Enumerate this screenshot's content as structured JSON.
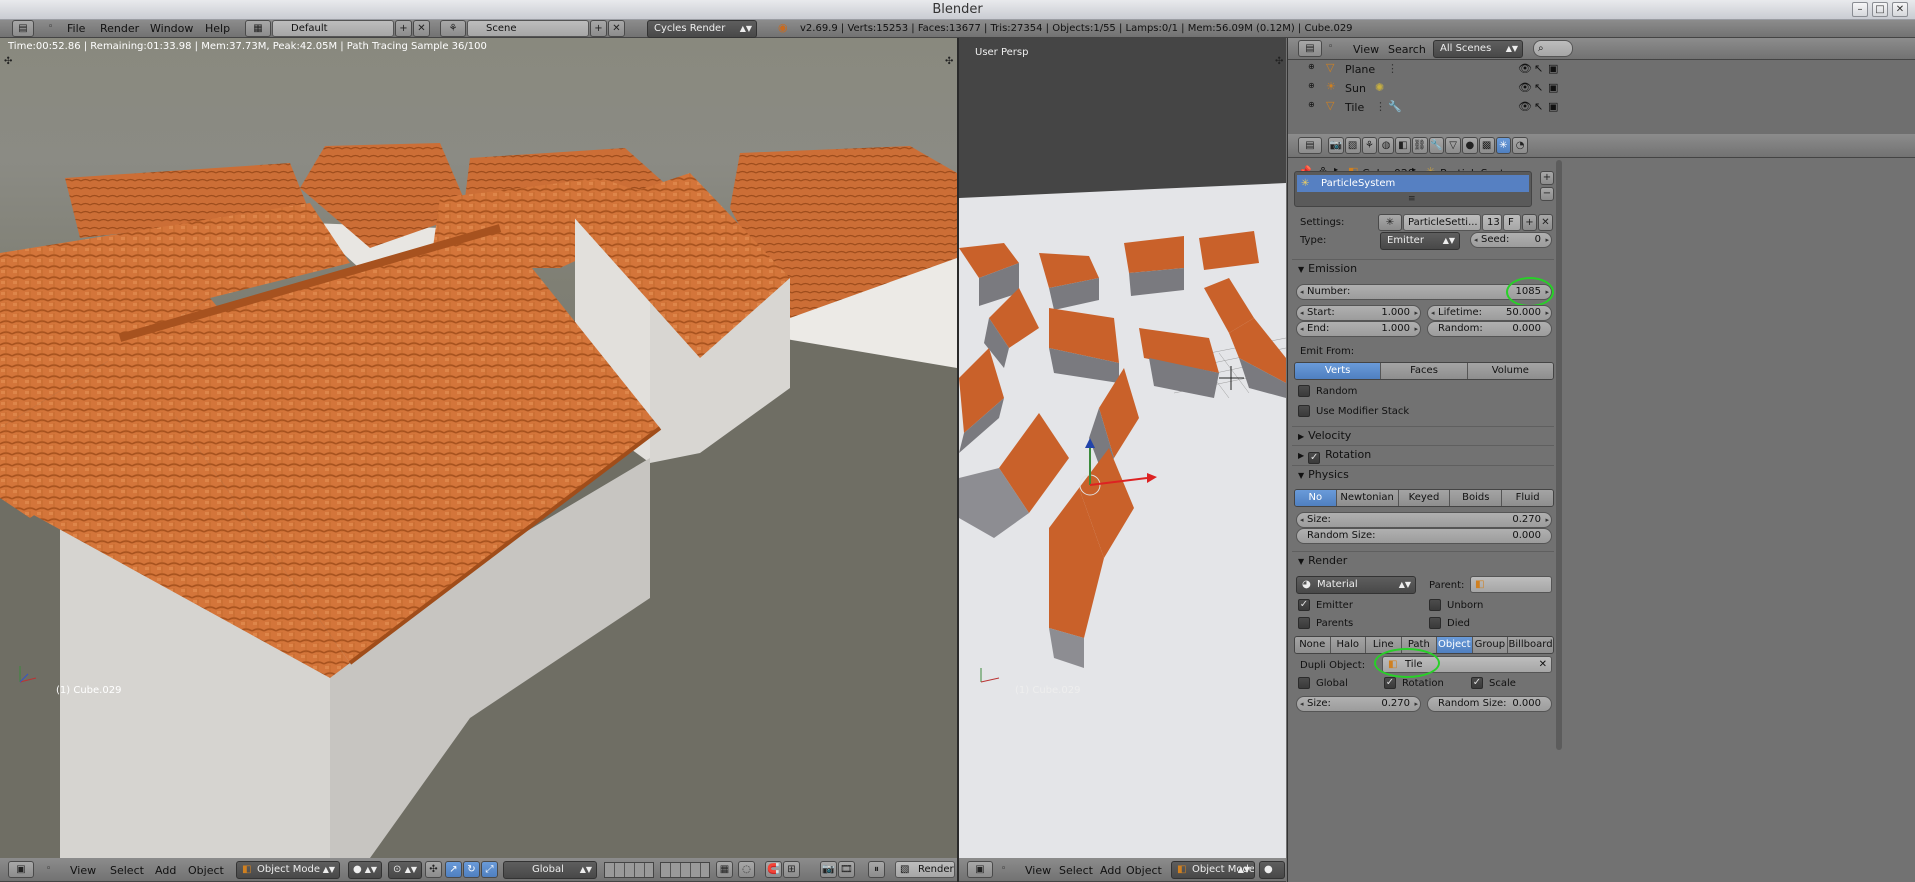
{
  "window": {
    "title": "Blender",
    "min": "–",
    "max": "□",
    "close": "✕"
  },
  "top": {
    "menus": [
      "File",
      "Render",
      "Window",
      "Help"
    ],
    "layout": "Default",
    "scene": "Scene",
    "engine": "Cycles Render",
    "stats": "v2.69.9 | Verts:15253 | Faces:13677 | Tris:27354 | Objects:1/55 | Lamps:0/1 | Mem:56.09M (0.12M) | Cube.029"
  },
  "render_view": {
    "status": "Time:00:52.86 | Remaining:01:33.98 | Mem:37.73M, Peak:42.05M | Path Tracing Sample 36/100",
    "object_label": "(1) Cube.029"
  },
  "viewport": {
    "label": "User Persp",
    "object_label": "(1) Cube.029"
  },
  "outliner": {
    "view": "View",
    "search": "Search",
    "scenes": "All Scenes",
    "rows": [
      {
        "name": "Plane"
      },
      {
        "name": "Sun"
      },
      {
        "name": "Tile"
      }
    ]
  },
  "props": {
    "breadcrumb": {
      "object": "Cube.029",
      "system": "ParticleSystem"
    },
    "system_item": "ParticleSystem",
    "settings_label": "Settings:",
    "settings_value": "ParticleSetti...",
    "settings_users": "13",
    "settings_fake": "F",
    "type_label": "Type:",
    "type_value": "Emitter",
    "seed_label": "Seed:",
    "seed_value": "0",
    "emission": {
      "title": "Emission",
      "number_label": "Number:",
      "number_value": "1085",
      "start_label": "Start:",
      "start_value": "1.000",
      "end_label": "End:",
      "end_value": "1.000",
      "lifetime_label": "Lifetime:",
      "lifetime_value": "50.000",
      "random_label": "Random:",
      "random_value": "0.000",
      "emit_from_label": "Emit From:",
      "emit_from": [
        "Verts",
        "Faces",
        "Volume"
      ],
      "random_cb": "Random",
      "modifier_cb": "Use Modifier Stack"
    },
    "velocity": "Velocity",
    "rotation": "Rotation",
    "physics": {
      "title": "Physics",
      "types": [
        "No",
        "Newtonian",
        "Keyed",
        "Boids",
        "Fluid"
      ],
      "size_label": "Size:",
      "size_value": "0.270",
      "random_size_label": "Random Size:",
      "random_size_value": "0.000"
    },
    "render": {
      "title": "Render",
      "material": "Material",
      "parent_label": "Parent:",
      "emitter": "Emitter",
      "unborn": "Unborn",
      "parents": "Parents",
      "died": "Died",
      "modes": [
        "None",
        "Halo",
        "Line",
        "Path",
        "Object",
        "Group",
        "Billboard"
      ],
      "dupli_label": "Dupli Object:",
      "dupli_value": "Tile",
      "global": "Global",
      "rotation": "Rotation",
      "scale": "Scale",
      "size_label": "Size:",
      "size_value": "0.270",
      "random_size_label": "Random Size:",
      "random_size_value": "0.000"
    }
  },
  "bottom_left": {
    "menus": [
      "View",
      "Select",
      "Add",
      "Object"
    ],
    "mode": "Object Mode",
    "orientation": "Global",
    "layer": "RenderLayer"
  },
  "bottom_right": {
    "menus": [
      "View",
      "Select",
      "Add",
      "Object"
    ],
    "mode": "Object Mode"
  }
}
